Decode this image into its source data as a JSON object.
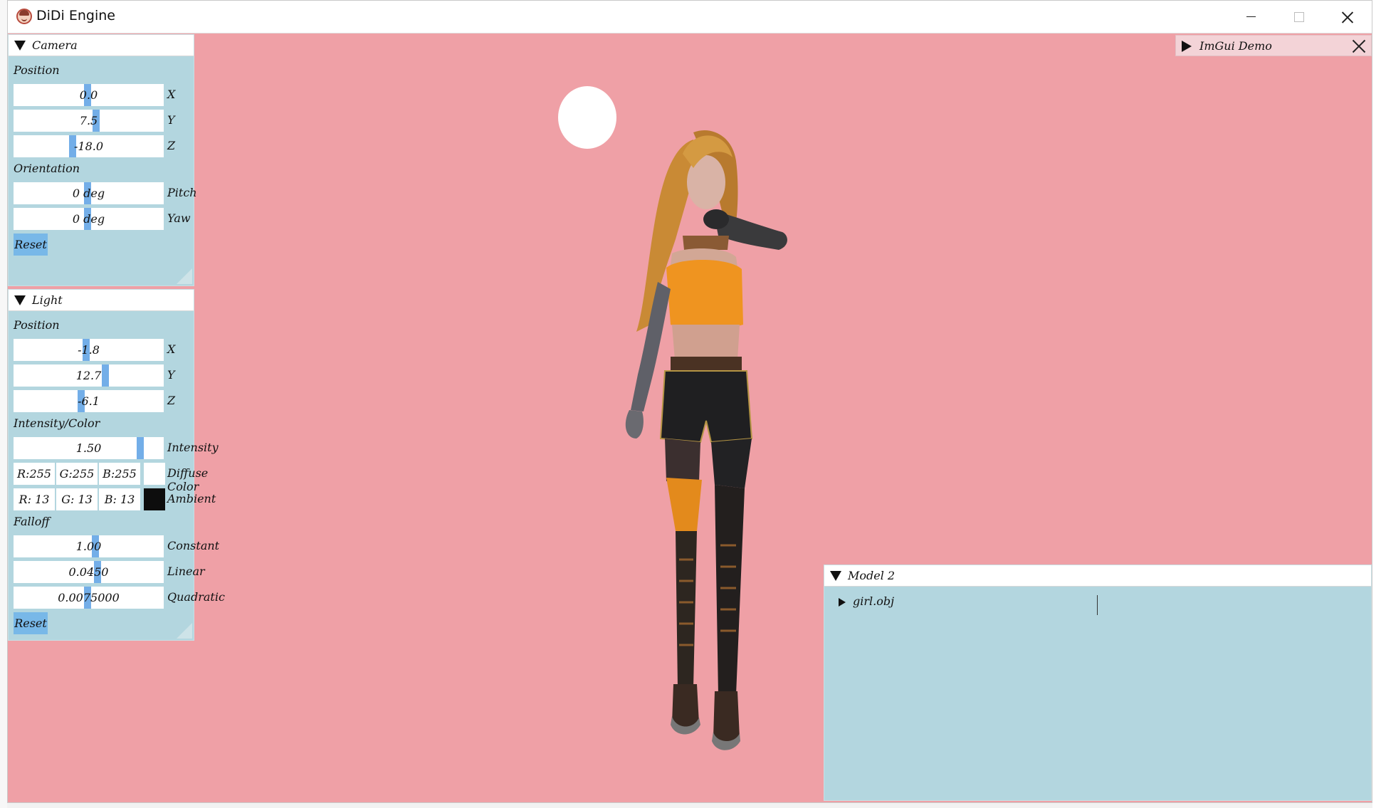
{
  "window": {
    "title": "DiDi Engine"
  },
  "camera": {
    "title": "Camera",
    "position_label": "Position",
    "orientation_label": "Orientation",
    "x": "0.0",
    "y": "7.5",
    "z": "-18.0",
    "x_label": "X",
    "y_label": "Y",
    "z_label": "Z",
    "pitch": "0 deg",
    "yaw": "0 deg",
    "pitch_label": "Pitch",
    "yaw_label": "Yaw",
    "reset": "Reset"
  },
  "light": {
    "title": "Light",
    "position_label": "Position",
    "x": "-1.8",
    "y": "12.7",
    "z": "-6.1",
    "x_label": "X",
    "y_label": "Y",
    "z_label": "Z",
    "intensity_color_label": "Intensity/Color",
    "intensity": "1.50",
    "intensity_label": "Intensity",
    "diffuse": {
      "r": "R:255",
      "g": "G:255",
      "b": "B:255",
      "label": "Diffuse Color",
      "swatch": "#ffffff"
    },
    "ambient": {
      "r": "R: 13",
      "g": "G: 13",
      "b": "B: 13",
      "label": "Ambient",
      "swatch": "#0d0d0d"
    },
    "falloff_label": "Falloff",
    "constant": "1.00",
    "constant_label": "Constant",
    "linear": "0.0450",
    "linear_label": "Linear",
    "quadratic": "0.0075000",
    "quadratic_label": "Quadratic",
    "reset": "Reset"
  },
  "imgui_demo": {
    "title": "ImGui Demo"
  },
  "model_panel": {
    "title": "Model 2",
    "items": [
      {
        "label": "girl.obj"
      }
    ]
  },
  "colors": {
    "viewport_bg": "#efa0a6",
    "panel_bg": "#b3d6df",
    "slider_grab": "#73aee8",
    "button": "#78b8e8"
  }
}
